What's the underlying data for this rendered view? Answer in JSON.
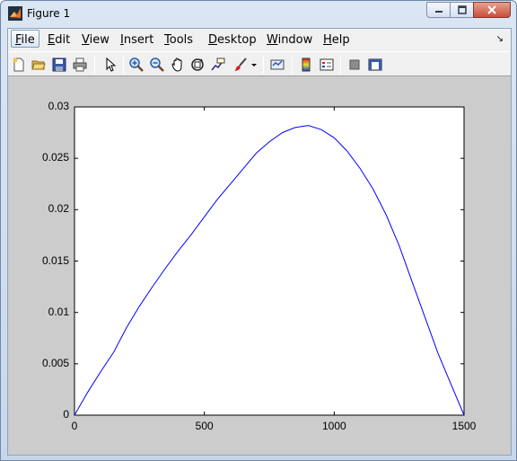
{
  "window": {
    "title": "Figure 1",
    "controls": [
      "minimize",
      "restore",
      "close"
    ]
  },
  "menu": {
    "items": [
      {
        "label": "File",
        "mnemonic": "F"
      },
      {
        "label": "Edit",
        "mnemonic": "E"
      },
      {
        "label": "View",
        "mnemonic": "V"
      },
      {
        "label": "Insert",
        "mnemonic": "I"
      },
      {
        "label": "Tools",
        "mnemonic": "T"
      },
      {
        "label": "Desktop",
        "mnemonic": "D"
      },
      {
        "label": "Window",
        "mnemonic": "W"
      },
      {
        "label": "Help",
        "mnemonic": "H"
      }
    ],
    "active_index": 0
  },
  "toolbar": {
    "icons": [
      "new-figure-icon",
      "open-file-icon",
      "save-icon",
      "print-icon",
      "edit-plot-arrow-icon",
      "zoom-in-icon",
      "zoom-out-icon",
      "pan-hand-icon",
      "rotate-3d-icon",
      "data-cursor-icon",
      "brush-icon",
      "link-plot-icon",
      "colorbar-icon",
      "legend-icon",
      "hide-plot-tools-icon",
      "show-plot-tools-icon"
    ]
  },
  "colors": {
    "line": "#0000ff",
    "figure_bg": "#cccccc",
    "axes_bg": "#ffffff"
  },
  "chart_data": {
    "type": "line",
    "title": "",
    "xlabel": "",
    "ylabel": "",
    "xlim": [
      0,
      1500
    ],
    "ylim": [
      0,
      0.03
    ],
    "xticks": [
      "0",
      "500",
      "1000",
      "1500"
    ],
    "yticks": [
      "0",
      "0.005",
      "0.01",
      "0.015",
      "0.02",
      "0.025",
      "0.03"
    ],
    "grid": false,
    "series": [
      {
        "x": [
          0,
          50,
          100,
          150,
          200,
          250,
          300,
          350,
          400,
          450,
          500,
          550,
          600,
          650,
          700,
          750,
          800,
          850,
          900,
          950,
          1000,
          1050,
          1100,
          1150,
          1200,
          1250,
          1300,
          1350,
          1400,
          1450,
          1500
        ],
        "values": [
          0,
          0.0022,
          0.0042,
          0.0061,
          0.0085,
          0.0106,
          0.0125,
          0.0143,
          0.016,
          0.0176,
          0.0193,
          0.021,
          0.0225,
          0.024,
          0.0255,
          0.0266,
          0.0275,
          0.028,
          0.0282,
          0.0278,
          0.027,
          0.0257,
          0.024,
          0.022,
          0.0195,
          0.0165,
          0.013,
          0.0095,
          0.006,
          0.003,
          0
        ]
      }
    ]
  }
}
